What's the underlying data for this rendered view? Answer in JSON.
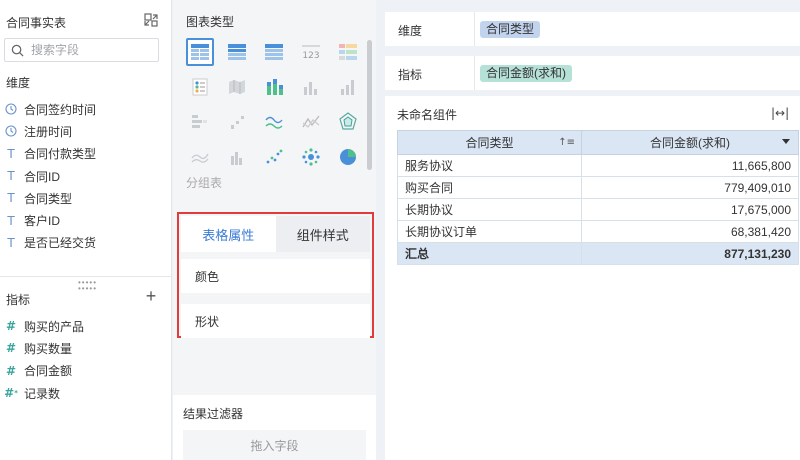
{
  "left_panel": {
    "title": "合同事实表",
    "search_placeholder": "搜索字段",
    "dimensions_label": "维度",
    "dimensions": [
      {
        "label": "合同签约时间",
        "icon": "clock-icon"
      },
      {
        "label": "注册时间",
        "icon": "clock-icon"
      },
      {
        "label": "合同付款类型",
        "icon": "text-type-icon"
      },
      {
        "label": "合同ID",
        "icon": "text-type-icon"
      },
      {
        "label": "合同类型",
        "icon": "text-type-icon"
      },
      {
        "label": "客户ID",
        "icon": "text-type-icon"
      },
      {
        "label": "是否已经交货",
        "icon": "text-type-icon"
      }
    ],
    "measures_label": "指标",
    "measures": [
      {
        "label": "购买的产品",
        "icon": "number-type-icon"
      },
      {
        "label": "购买数量",
        "icon": "number-type-icon"
      },
      {
        "label": "合同金额",
        "icon": "number-type-icon"
      },
      {
        "label": "记录数",
        "icon": "count-type-icon"
      }
    ]
  },
  "middle_panel": {
    "chart_types_title": "图表类型",
    "group_table_label": "分组表",
    "tabs": [
      {
        "label": "表格属性",
        "active": true
      },
      {
        "label": "组件样式",
        "active": false
      }
    ],
    "properties": [
      "颜色",
      "形状"
    ],
    "result_filter_title": "结果过滤器",
    "drop_zone_text": "拖入字段"
  },
  "right_panel": {
    "dimension_shelf_label": "维度",
    "dimension_pill": "合同类型",
    "measure_shelf_label": "指标",
    "measure_pill": "合同金额(求和)",
    "component_title": "未命名组件",
    "table": {
      "headers": [
        "合同类型",
        "合同金额(求和)"
      ],
      "rows": [
        [
          "服务协议",
          "11,665,800"
        ],
        [
          "购买合同",
          "779,409,010"
        ],
        [
          "长期协议",
          "17,675,000"
        ],
        [
          "长期协议订单",
          "68,381,420"
        ]
      ],
      "total": [
        "汇总",
        "877,131,230"
      ]
    }
  },
  "colors": {
    "accent": "#3a7bd5",
    "highlight_border": "#e23b3b",
    "dimension_pill": "#c2d3ee",
    "measure_pill": "#b6e1d7",
    "table_header": "#dbe6f5"
  }
}
